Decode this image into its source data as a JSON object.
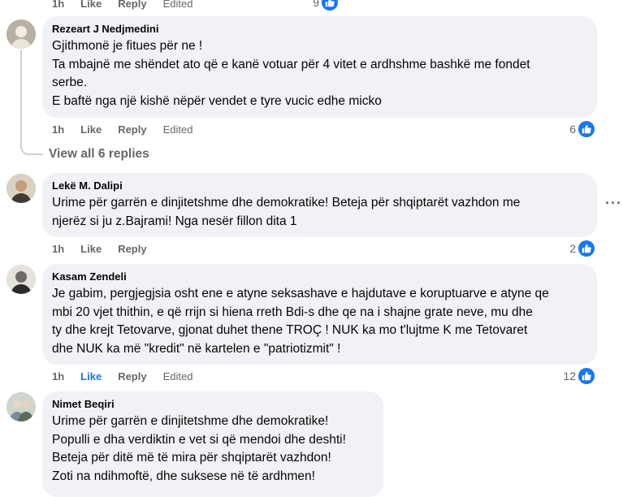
{
  "top_actions": {
    "time": "1h",
    "like": "Like",
    "reply": "Reply",
    "edited": "Edited",
    "count": "9"
  },
  "comments": [
    {
      "author": "Rezeart J Nedjmedini",
      "lines": [
        "Gjithmonë je fitues për ne !",
        "Ta mbajnë me shëndet ato që e kanë votuar për 4 vitet e ardhshme bashkë me fondet",
        "serbe.",
        "E baftë nga një kishë nëpër vendet e tyre vucic edhe micko"
      ],
      "time": "1h",
      "like": "Like",
      "reply": "Reply",
      "edited": "Edited",
      "count": "6"
    },
    {
      "author": "Lekë M. Dalipi",
      "lines": [
        "Urime për garrën e dinjitetshme dhe demokratike! Beteja për shqiptarët vazhdon me",
        "njerëz si ju z.Bajrami! Nga nesër fillon dita 1"
      ],
      "time": "1h",
      "like": "Like",
      "reply": "Reply",
      "count": "2"
    },
    {
      "author": "Kasam Zendeli",
      "lines": [
        "Je gabim, pergjegjsia osht ene e atyne seksashave e hajdutave e koruptuarve e atyne qe",
        "mbi 20 vjet thithin, e që rrijn si hiena rreth Bdi-s dhe qe na i shajne grate neve, mu dhe",
        "ty dhe krejt Tetovarve, gjonat duhet thene TROÇ ! NUK ka mo t'lujtme K me Tetovaret",
        "dhe NUK ka më \"kredit\" në kartelen e \"patriotizmit\" !"
      ],
      "time": "1h",
      "like": "Like",
      "reply": "Reply",
      "edited": "Edited",
      "count": "12"
    },
    {
      "author": "Nimet Beqiri",
      "lines": [
        "Urime për garrën e dinjitetshme dhe demokratike!",
        "Populli e dha verdiktin e vet si që mendoi dhe deshti!",
        "Beteja për ditë më të mira për shqiptarët vazhdon!",
        "Zoti na ndihmoftë, dhe suksese në të ardhmen!"
      ]
    }
  ],
  "view_replies": "View all 6 replies",
  "more_menu": "···",
  "colors": {
    "bubble": "#f0f2f5",
    "meta": "#65676b",
    "accent": "#1877f2",
    "text": "#050505"
  }
}
